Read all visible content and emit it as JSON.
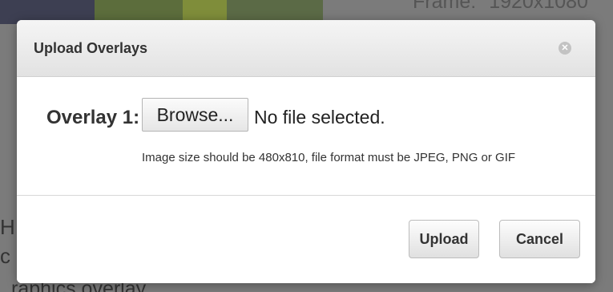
{
  "background": {
    "frame_label": "Frame:",
    "frame_value": "1920x1080",
    "side_heading_fragment": "H",
    "side_text_fragment": "c",
    "graphics_text": "raphics overlay"
  },
  "dialog": {
    "title": "Upload Overlays",
    "close_icon": "close-icon",
    "field_label": "Overlay 1:",
    "browse_label": "Browse...",
    "file_status": "No file selected.",
    "hint": "Image size should be 480x810, file format must be JPEG, PNG or GIF",
    "upload_label": "Upload",
    "cancel_label": "Cancel"
  }
}
